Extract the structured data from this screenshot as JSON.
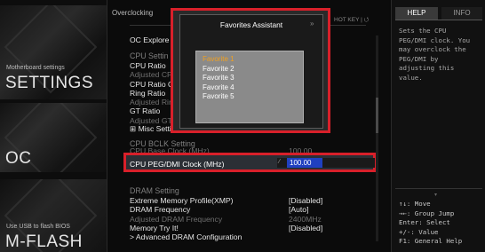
{
  "sidebar": {
    "settings": {
      "small": "Motherboard settings",
      "big": "SETTINGS"
    },
    "oc": {
      "big": "OC"
    },
    "mflash": {
      "small": "Use USB to flash BIOS",
      "big": "M-FLASH"
    }
  },
  "header": {
    "breadcrumb": "Overclocking",
    "hotkey": "HOT KEY | ⭯"
  },
  "rows": [
    {
      "label": "OC Explore Mod",
      "value": "]",
      "style": "normal"
    },
    {
      "label": "CPU Settin",
      "value": "",
      "style": "sec"
    },
    {
      "label": "CPU Ratio",
      "value": "",
      "style": "normal"
    },
    {
      "label": "Adjusted CPU F",
      "value": "",
      "style": "dim"
    },
    {
      "label": "CPU Ratio O",
      "value": "",
      "style": "normal"
    },
    {
      "label": "Ring Ratio",
      "value": "",
      "style": "normal"
    },
    {
      "label": "Adjusted Ring F",
      "value": "",
      "style": "dim"
    },
    {
      "label": "GT Ratio",
      "value": "",
      "style": "normal"
    },
    {
      "label": "Adjusted GT F",
      "value": "",
      "style": "dim"
    },
    {
      "label": "⊞ Misc Setting",
      "value": "",
      "style": "normal"
    },
    {
      "label": "CPU BCLK  Setting",
      "value": "",
      "style": "sec"
    },
    {
      "label": "CPU Base Clock (MHz)",
      "value": "100.00",
      "style": "dim"
    },
    {
      "label": "DRAM Setting",
      "value": "",
      "style": "sec"
    },
    {
      "label": "Extreme Memory Profile(XMP)",
      "value": "[Disabled]",
      "style": "normal"
    },
    {
      "label": "DRAM Frequency",
      "value": "[Auto]",
      "style": "normal"
    },
    {
      "label": "Adjusted DRAM Frequency",
      "value": "2400MHz",
      "style": "dim"
    },
    {
      "label": "Memory Try It!",
      "value": "[Disabled]",
      "style": "normal"
    },
    {
      "label": "> Advanced DRAM Configuration",
      "value": "",
      "style": "normal"
    }
  ],
  "highlighted_row": {
    "label": "CPU PEG/DMI Clock (MHz)",
    "value": "100.00"
  },
  "dialog": {
    "title": "Favorites Assistant",
    "close": "»",
    "items": [
      "Favorite 1",
      "Favorite 2",
      "Favorite 3",
      "Favorite 4",
      "Favorite 5"
    ]
  },
  "help": {
    "tabs": [
      "HELP",
      "INFO"
    ],
    "text_lines": [
      "Sets the CPU",
      "PEG/DMI clock. You",
      "may overclock the",
      "PEG/DMI by",
      "adjusting this",
      "value."
    ],
    "keys": [
      "↑↓: Move",
      "→←: Group Jump",
      "Enter: Select",
      "+/-: Value",
      "F1: General Help"
    ]
  },
  "colors": {
    "accent": "#d8202a",
    "selected_item": "#f0a020",
    "field_blue": "#2040c0"
  }
}
